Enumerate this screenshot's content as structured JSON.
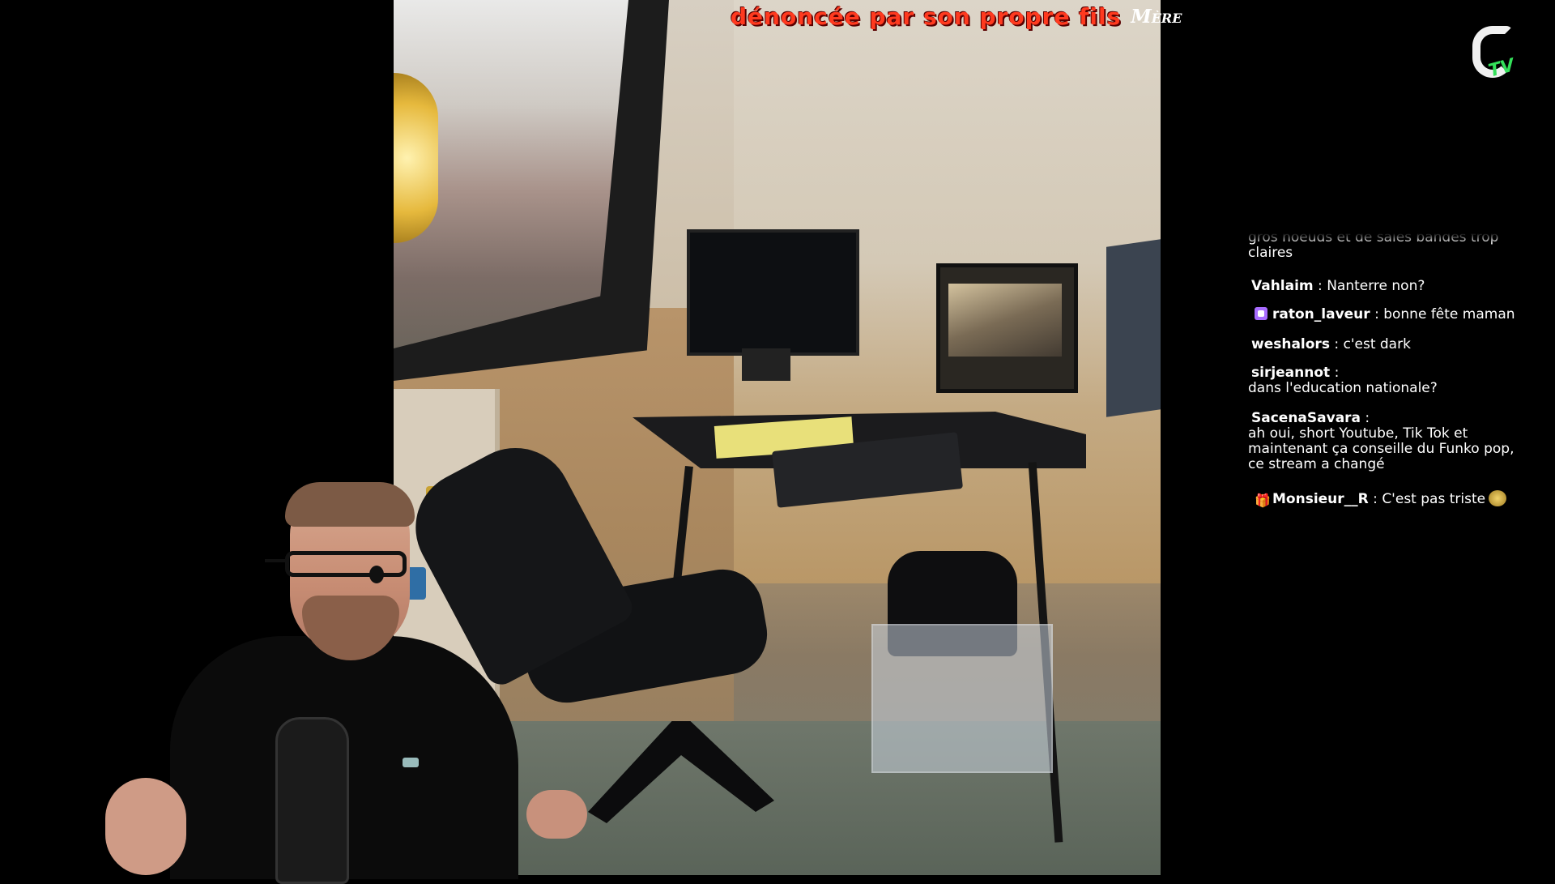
{
  "caption": {
    "headline": "dénoncée par son propre fils",
    "tag": "Mère"
  },
  "channel_logo": {
    "letter": "G",
    "suffix": "TV",
    "accent": "#34e05a"
  },
  "chat": {
    "messages": [
      {
        "user": "",
        "text": "gros noeuds et de sales bandes trop claires",
        "badge": ""
      },
      {
        "user": "Vahlaim",
        "sep": " : ",
        "text": "Nanterre non?",
        "badge": ""
      },
      {
        "user": "raton_laveur",
        "sep": " : ",
        "text": "bonne fête maman",
        "badge": "sub-badge"
      },
      {
        "user": "weshalors",
        "sep": " : ",
        "text": "c'est dark",
        "badge": ""
      },
      {
        "user": "sirjeannot",
        "sep": " :",
        "text": "dans l'education nationale?",
        "badge": ""
      },
      {
        "user": "SacenaSavara",
        "sep": " :",
        "text": "ah oui, short Youtube, Tik Tok et maintenant ça conseille du Funko pop, ce stream a changé",
        "badge": ""
      },
      {
        "user": "Monsieur__R",
        "sep": " : ",
        "text": "C'est pas triste",
        "badge": "gift-badge",
        "emote": "emote"
      }
    ]
  },
  "colors": {
    "caption_red": "#ff3a1f",
    "chat_text": "#ffffff",
    "background": "#000000"
  }
}
